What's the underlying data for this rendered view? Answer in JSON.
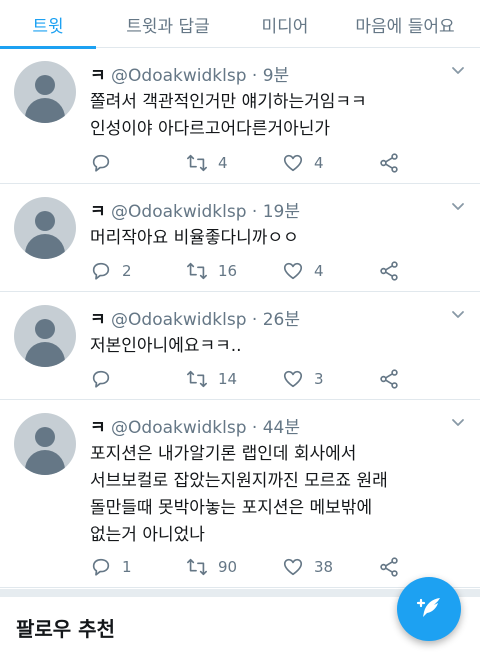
{
  "tabs": [
    {
      "label": "트윗"
    },
    {
      "label": "트윗과 답글"
    },
    {
      "label": "미디어"
    },
    {
      "label": "마음에 들어요"
    }
  ],
  "tweets": [
    {
      "name": "ㅋ",
      "handle": "@Odoakwidklsp",
      "time": "9분",
      "lines": [
        "쫄려서 객관적인거만 얘기하는거임ㅋㅋ",
        "인성이야 아다르고어다른거아닌가"
      ],
      "replies": "",
      "retweets": "4",
      "likes": "4"
    },
    {
      "name": "ㅋ",
      "handle": "@Odoakwidklsp",
      "time": "19분",
      "lines": [
        "머리작아요 비율좋다니까ㅇㅇ"
      ],
      "replies": "2",
      "retweets": "16",
      "likes": "4"
    },
    {
      "name": "ㅋ",
      "handle": "@Odoakwidklsp",
      "time": "26분",
      "lines": [
        "저본인아니에요ㅋㅋ.."
      ],
      "replies": "",
      "retweets": "14",
      "likes": "3"
    },
    {
      "name": "ㅋ",
      "handle": "@Odoakwidklsp",
      "time": "44분",
      "lines": [
        "포지션은 내가알기론 랩인데 회사에서",
        "서브보컬로 잡았는지원지까진 모르죠 원래",
        "돌만들때 못박아놓는 포지션은 메보밖에",
        "없는거 아니었나"
      ],
      "replies": "1",
      "retweets": "90",
      "likes": "38"
    }
  ],
  "separator_dot": "·",
  "follow_title": "팔로우 추천",
  "colors": {
    "accent": "#1da1f2",
    "muted": "#657786",
    "divider": "#e1e8ed"
  },
  "icons": {
    "reply": "reply-icon",
    "retweet": "retweet-icon",
    "like": "heart-icon",
    "share": "share-icon",
    "compose": "compose-icon",
    "caret": "chevron-down-icon"
  }
}
